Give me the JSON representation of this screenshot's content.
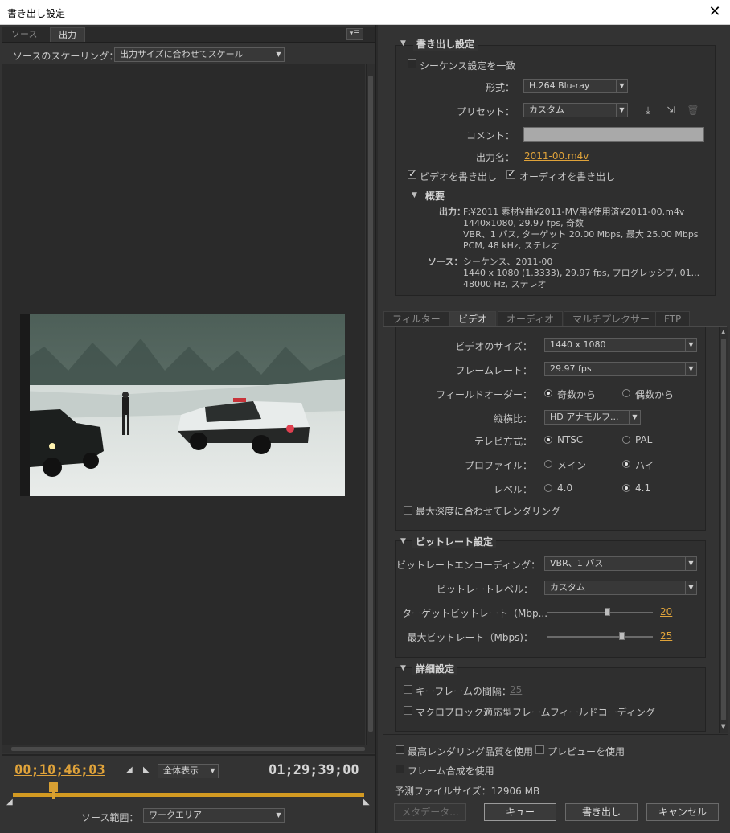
{
  "window": {
    "title": "書き出し設定",
    "close_glyph": "✕"
  },
  "left": {
    "tabs": [
      "ソース",
      "出力"
    ],
    "scaling_label": "ソースのスケーリング：",
    "scaling_value": "出力サイズに合わせてスケール",
    "timecode_current": "00;10;46;03",
    "timecode_total": "01;29;39;00",
    "zoom_value": "全体表示",
    "source_range_label": "ソース範囲：",
    "source_range_value": "ワークエリア"
  },
  "export_settings": {
    "title": "書き出し設定",
    "match_sequence": "シーケンス設定を一致",
    "format_label": "形式：",
    "format_value": "H.264 Blu-ray",
    "preset_label": "プリセット：",
    "preset_value": "カスタム",
    "comment_label": "コメント：",
    "output_name_label": "出力名：",
    "output_name_value": "2011-00.m4v",
    "export_video": "ビデオを書き出し",
    "export_audio": "オーディオを書き出し",
    "summary_title": "概要",
    "output_key": "出力：",
    "output_lines": [
      "F:¥2011 素材¥曲¥2011-MV用¥使用済¥2011-00.m4v",
      "1440x1080, 29.97 fps, 奇数",
      "VBR、1 パス, ターゲット 20.00 Mbps, 最大 25.00 Mbps",
      "PCM, 48 kHz, ステレオ"
    ],
    "source_key": "ソース：",
    "source_lines": [
      "シーケンス、2011-00",
      "1440 x 1080 (1.3333), 29.97 fps, プログレッシブ, 01...",
      "48000 Hz, ステレオ"
    ]
  },
  "tabs": [
    "フィルター",
    "ビデオ",
    "オーディオ",
    "マルチプレクサー",
    "FTP"
  ],
  "video": {
    "size_label": "ビデオのサイズ：",
    "size_value": "1440 x 1080",
    "framerate_label": "フレームレート：",
    "framerate_value": "29.97 fps",
    "field_order_label": "フィールドオーダー：",
    "field_odd": "奇数から",
    "field_even": "偶数から",
    "aspect_label": "縦横比：",
    "aspect_value": "HD アナモルフ...",
    "tv_label": "テレビ方式：",
    "tv_ntsc": "NTSC",
    "tv_pal": "PAL",
    "profile_label": "プロファイル：",
    "profile_main": "メイン",
    "profile_high": "ハイ",
    "level_label": "レベル：",
    "level_40": "4.0",
    "level_41": "4.1",
    "max_depth": "最大深度に合わせてレンダリング"
  },
  "bitrate": {
    "title": "ビットレート設定",
    "encoding_label": "ビットレートエンコーディング：",
    "encoding_value": "VBR、1 パス",
    "level_label": "ビットレートレベル：",
    "level_value": "カスタム",
    "target_label": "ターゲットビットレート（Mbp...",
    "target_value": "20",
    "target_fraction": 0.57,
    "max_label": "最大ビットレート（Mbps)：",
    "max_value": "25",
    "max_fraction": 0.71
  },
  "advanced": {
    "title": "詳細設定",
    "keyframe_label": "キーフレームの間隔：",
    "keyframe_value": "25",
    "macroblock_label": "マクロブロック適応型フレームフィールドコーディング"
  },
  "footer": {
    "max_quality": "最高レンダリング品質を使用",
    "use_preview": "プレビューを使用",
    "frame_blend": "フレーム合成を使用",
    "estimated_size": "予測ファイルサイズ：12906 MB",
    "metadata_btn": "メタデータ...",
    "queue_btn": "キュー",
    "export_btn": "書き出し",
    "cancel_btn": "キャンセル"
  },
  "colors": {
    "accent": "#e8a93b",
    "panel": "#333333",
    "dark": "#2b2b2b"
  }
}
